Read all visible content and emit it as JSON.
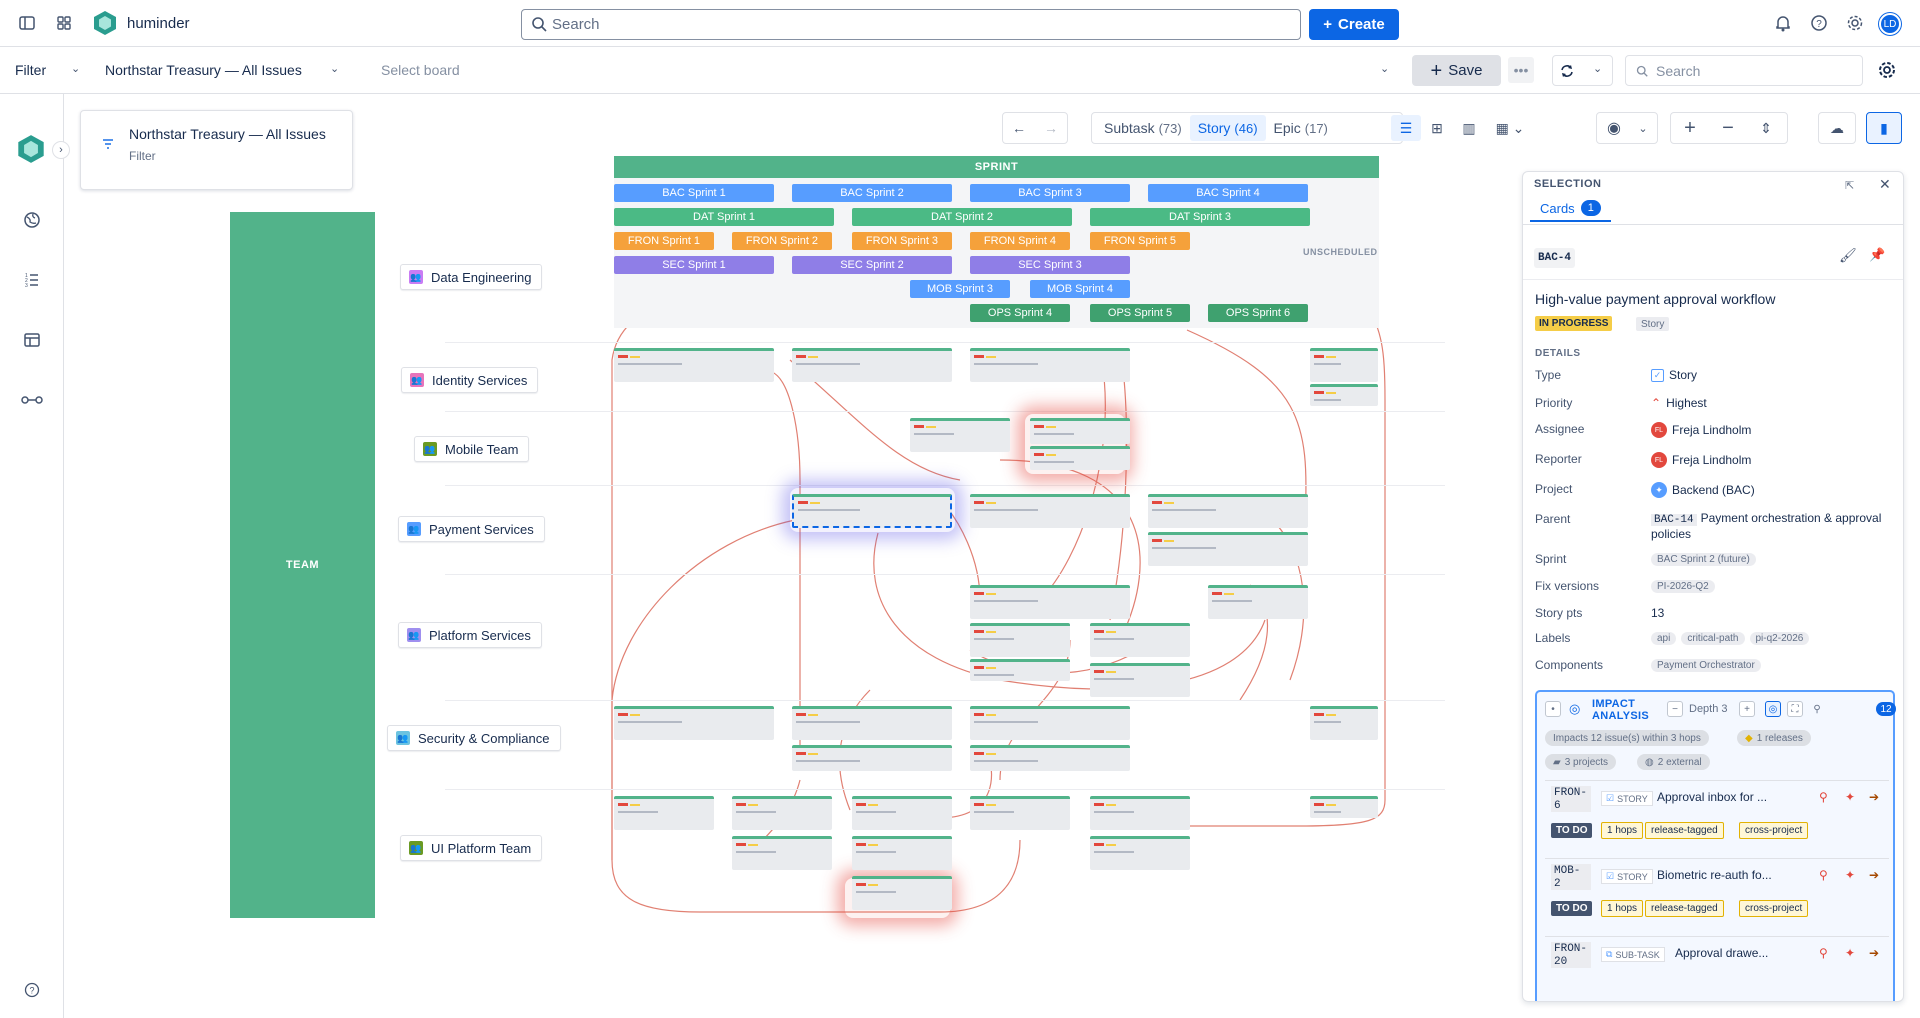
{
  "app": {
    "name": "huminder",
    "user_initials": "LD"
  },
  "topbar": {
    "search_placeholder": "Search",
    "create_label": "Create"
  },
  "filterbar": {
    "filter_label": "Filter",
    "view_name": "Northstar Treasury — All Issues",
    "board_placeholder": "Select board",
    "save_label": "Save",
    "more_label": "•••",
    "search_placeholder": "Search"
  },
  "filter_card": {
    "title": "Northstar Treasury — All Issues",
    "subtitle": "Filter"
  },
  "toolbar": {
    "types": [
      {
        "label": "Subtask",
        "count": "(73)",
        "selected": false
      },
      {
        "label": "Story",
        "count": "(46)",
        "selected": true
      },
      {
        "label": "Epic",
        "count": "(17)",
        "selected": false
      }
    ]
  },
  "board": {
    "team_column_label": "TEAM",
    "sprint_header": "SPRINT",
    "unscheduled_label": "UNSCHEDULED",
    "teams": [
      "Data Engineering",
      "Identity Services",
      "Mobile Team",
      "Payment Services",
      "Platform Services",
      "Security & Compliance",
      "UI Platform Team"
    ],
    "sprints": [
      "BAC Sprint 1",
      "BAC Sprint 2",
      "BAC Sprint 3",
      "BAC Sprint 4",
      "DAT Sprint 1",
      "DAT Sprint 2",
      "DAT Sprint 3",
      "FRON Sprint 1",
      "FRON Sprint 2",
      "FRON Sprint 3",
      "FRON Sprint 4",
      "FRON Sprint 5",
      "SEC Sprint 1",
      "SEC Sprint 2",
      "SEC Sprint 3",
      "MOB Sprint 3",
      "MOB Sprint 4",
      "OPS Sprint 4",
      "OPS Sprint 5",
      "OPS Sprint 6"
    ]
  },
  "selection": {
    "header": "SELECTION",
    "tab_label": "Cards",
    "tab_count": "1",
    "key": "BAC-4",
    "title": "High-value payment approval workflow",
    "status": "IN PROGRESS",
    "type_chip": "Story",
    "details_header": "DETAILS",
    "details": {
      "type_label": "Type",
      "type_value": "Story",
      "priority_label": "Priority",
      "priority_value": "Highest",
      "assignee_label": "Assignee",
      "assignee_value": "Freja Lindholm",
      "assignee_initials": "FL",
      "reporter_label": "Reporter",
      "reporter_value": "Freja Lindholm",
      "reporter_initials": "FL",
      "project_label": "Project",
      "project_value": "Backend (BAC)",
      "parent_label": "Parent",
      "parent_key": "BAC-14",
      "parent_value": "Payment orchestration & approval policies",
      "sprint_label": "Sprint",
      "sprint_value": "BAC Sprint 2 (future)",
      "fixversions_label": "Fix versions",
      "fixversions_value": "PI-2026-Q2",
      "storypts_label": "Story pts",
      "storypts_value": "13",
      "labels_label": "Labels",
      "labels": [
        "api",
        "critical-path",
        "pi-q2-2026"
      ],
      "components_label": "Components",
      "components_value": "Payment Orchestrator"
    },
    "impact": {
      "title_line1": "IMPACT",
      "title_line2": "ANALYSIS",
      "depth_label": "Depth 3",
      "count": "12",
      "summary": "Impacts 12 issue(s) within 3 hops",
      "releases": "1 releases",
      "projects": "3 projects",
      "external": "2 external",
      "rows": [
        {
          "key_line1": "FRON-",
          "key_line2": "6",
          "type": "STORY",
          "summary": "Approval inbox for ...",
          "status": "TO DO",
          "hops": "1 hops",
          "tag1": "release-tagged",
          "tag2": "cross-project"
        },
        {
          "key_line1": "MOB-",
          "key_line2": "2",
          "type": "STORY",
          "summary": "Biometric re-auth fo...",
          "status": "TO DO",
          "hops": "1 hops",
          "tag1": "release-tagged",
          "tag2": "cross-project"
        },
        {
          "key_line1": "FRON-",
          "key_line2": "20",
          "type": "SUB-TASK",
          "summary": "Approval drawe...",
          "status": "",
          "hops": "",
          "tag1": "",
          "tag2": ""
        }
      ]
    }
  }
}
